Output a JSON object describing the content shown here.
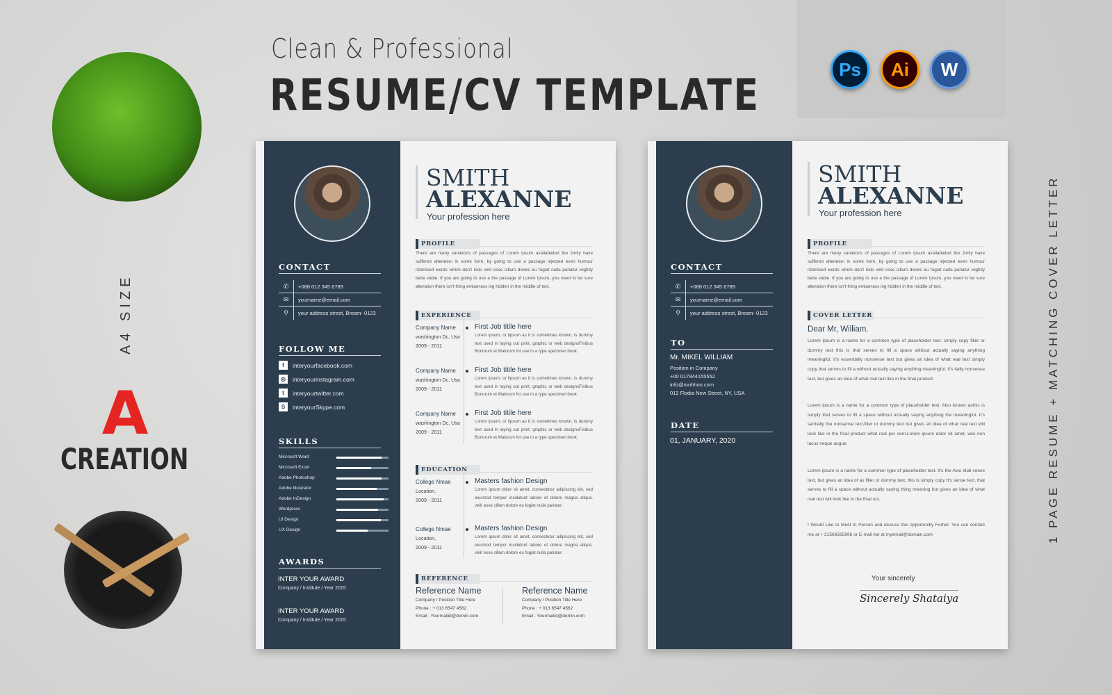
{
  "header": {
    "subtitle": "Clean & Professional",
    "title": "RESUME/CV TEMPLATE"
  },
  "apps": [
    {
      "label": "Ps",
      "icon": "photoshop-icon",
      "color": "#31a8ff",
      "bg": "#001e36"
    },
    {
      "label": "Ai",
      "icon": "illustrator-icon",
      "color": "#ff9a00",
      "bg": "#330000"
    },
    {
      "label": "W",
      "icon": "word-icon",
      "color": "#ffffff",
      "bg": "#2b579a"
    }
  ],
  "side_text_left": "A4 SIZE",
  "side_text_right": "1 PAGE RESUME + MATCHING COVER LETTER",
  "brand": {
    "logo_letter": "A",
    "logo_text": "CREATION"
  },
  "colors": {
    "sidebar": "#2c3e4e",
    "page": "#f2f2f2",
    "background": "#d6d6d5"
  },
  "resume": {
    "first_name": "SMITH",
    "last_name": "ALEXANNE",
    "profession": "Your profession here",
    "contact_title": "CONTACT",
    "contact": [
      {
        "icon": "phone-icon",
        "glyph": "✆",
        "text": "+088 012 345 6789"
      },
      {
        "icon": "mail-icon",
        "glyph": "✉",
        "text": "yourname@email.com"
      },
      {
        "icon": "location-icon",
        "glyph": "⚲",
        "text": "your address  street, Bream- 0123"
      }
    ],
    "follow_title": "FOLLOW ME",
    "social": [
      {
        "icon": "facebook-icon",
        "glyph": "f",
        "text": "interyourfacebook.com"
      },
      {
        "icon": "instagram-icon",
        "glyph": "◎",
        "text": "interyourinstagram.com"
      },
      {
        "icon": "twitter-icon",
        "glyph": "t",
        "text": "interyourtwitter.com"
      },
      {
        "icon": "skype-icon",
        "glyph": "S",
        "text": "interyourSkype.com"
      }
    ],
    "skills_title": "SKILLS",
    "skills": [
      {
        "name": "Microsoft Word",
        "level": 0.87
      },
      {
        "name": "Microsoft Excel",
        "level": 0.67
      },
      {
        "name": "Adobe Photoshop",
        "level": 0.87
      },
      {
        "name": "Adobe Illustrator",
        "level": 0.77
      },
      {
        "name": "Adobe InDesign",
        "level": 0.9
      },
      {
        "name": "Wordpress",
        "level": 0.8
      },
      {
        "name": "UI Design",
        "level": 0.85
      },
      {
        "name": "UX Design",
        "level": 0.6
      }
    ],
    "awards_title": "AWARDS",
    "awards": [
      {
        "title": "INTER YOUR AWARD",
        "sub": "Company / Institute / Year 2015"
      },
      {
        "title": "INTER YOUR AWARD",
        "sub": "Company / Institute / Year 2015"
      }
    ],
    "profile_title": "PROFILE",
    "profile": "There are many variations of passages of Lorem Ipsum availablebut the Jority have suffered alteration in some form, by going to use a passage  injected even humour rdomised words which don't look velit esse cillum dolore eu fugiat nulla pariatur slightly  belie vable. If you are going to use a the passage of Lorem Ipsum, you need to be sure alteration there isn't thing embarrass ing hidden in the middle of text.",
    "experience_title": "EXPERIENCE",
    "experience": [
      {
        "company": "Company Name",
        "location": "washington Dc, Usa",
        "years": "2009 - 2011",
        "title": "First Job titile here",
        "desc": "Lorem ipsum, or lipsum as it is sometimes known, is dummy text used in laying out print, graphic or web designsFinibus Bonorum et Malorum for use in a type specimen book."
      },
      {
        "company": "Company Name",
        "location": "washington Dc, Usa",
        "years": "2009 - 2011",
        "title": "First Job titile here",
        "desc": "Lorem ipsum, or lipsum as it is sometimes known, is dummy text used in laying out print, graphic or web designsFinibus Bonorum et Malorum for use in a type specimen book."
      },
      {
        "company": "Company Name",
        "location": "washington Dc, Usa",
        "years": "2009 - 2011",
        "title": "First Job titile here",
        "desc": "Lorem ipsum, or lipsum as it is sometimes known, is dummy text used in laying out print, graphic or web designsFinibus Bonorum et Malorum for use in a type specimen book."
      }
    ],
    "education_title": "EDUCATION",
    "education": [
      {
        "school": "College Nmae",
        "location": "Location,",
        "years": "2009 - 2011",
        "degree": "Masters fashion Design",
        "desc": "Lorem ipsum dolor sit amet, consectetur adipiscing elit, sed eiusmod tempor incididunt labore et dolore magna aliqua. velit esse cillum dolore eu fugiat nulla pariatur."
      },
      {
        "school": "College Nmae",
        "location": "Location,",
        "years": "2009 - 2011",
        "degree": "Masters fashion Design",
        "desc": "Lorem ipsum dolor sit amet, consectetur adipiscing elit, sed eiusmod tempor incididunt labore et dolore magna aliqua. velit esse cillum dolore eu fugiat nulla pariatur."
      }
    ],
    "reference_title": "REFERENCE",
    "references": [
      {
        "name": "Reference Name",
        "position": "Company / Position Title Here",
        "phone": "Phone : + 013 6547 4562",
        "email": "Email : Yourmailid@domin.com"
      },
      {
        "name": "Reference Name",
        "position": "Company / Position Title Here",
        "phone": "Phone : + 013 6547 4562",
        "email": "Email : Yourmailid@domin.com"
      }
    ]
  },
  "cover": {
    "to_title": "TO",
    "recipient": {
      "name": "Mr. MIKEL WILLIAM",
      "position": "Position in Company",
      "phone": "+00 017844155552",
      "email": "info@mohhon.com",
      "address": "012 Flodia  New Street, NY, USA"
    },
    "date_title": "DATE",
    "date": "01, JANUARY, 2020",
    "letter_title": "COVER LETTER",
    "greeting": "Dear Mr, William.",
    "paragraphs": [
      "Lorem ipsum is a name for a common type of placeholder text. simply copy filler or dummy text this is that serves to fill a space without actually saying anything meaningful. It's essentially nonsense text but gives an idea of what real text simply copy that serves to fill a without actually saying anything meaningful. It's tially nonsense text, but gives an idea of what real text  like in the final product.",
      "Lorem ipsum is a name for a common type of placeholder text. Also known asthis is simply that serves to fill a space without actually saying anything the meaningful. It's sentially the nonsense text,filler or dummy text but gives an idea of what real text will look like in the final product   what real  per sem.Lorem ipsum dolor sit amet, wisi non lacus neque augue.",
      "Lorem ipsum is a name for a common type of placeholder text. It's  the Also etial sense text, but gives an idea of  as filler or dummy text, this is simply copy It's sense text, that serves to fill a space without actually saying thing meaning but gives an idea of what real text will look like in the final uct.",
      "I Would Like to Meet In Person and discuss this opportunitly Forher. You can contact me at + 21566565896 or E-mail me at myemail@domain.com"
    ],
    "closing": "Your sincerely",
    "signature": "Sincerely Shataiya"
  }
}
